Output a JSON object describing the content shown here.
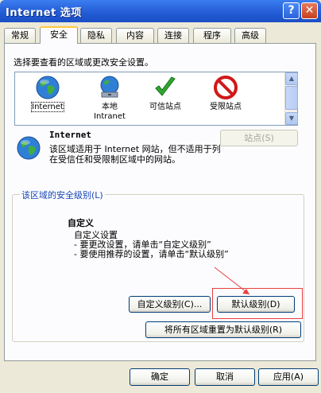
{
  "window": {
    "title": "Internet 选项"
  },
  "tabs": [
    {
      "label": "常规"
    },
    {
      "label": "安全",
      "active": true
    },
    {
      "label": "隐私"
    },
    {
      "label": "内容"
    },
    {
      "label": "连接"
    },
    {
      "label": "程序"
    },
    {
      "label": "高级"
    }
  ],
  "security": {
    "prompt": "选择要查看的区域或更改安全设置。",
    "zones": [
      {
        "label": "Internet",
        "icon": "globe-icon",
        "selected": true
      },
      {
        "label": "本地\nIntranet",
        "icon": "intranet-globe-icon"
      },
      {
        "label": "可信站点",
        "icon": "check-icon"
      },
      {
        "label": "受限站点",
        "icon": "no-entry-icon"
      }
    ],
    "zone_title": "Internet",
    "zone_description": "该区域适用于 Internet 网站，但不适用于列在受信任和受限制区域中的网站。",
    "sites_button": "站点(S)",
    "level_group_label": "该区域的安全级别(L)",
    "level_title": "自定义",
    "level_description": "自定义设置\n- 要更改设置，请单击“自定义级别”\n- 要使用推荐的设置，请单击“默认级别”",
    "custom_level_button": "自定义级别(C)...",
    "default_level_button": "默认级别(D)",
    "reset_all_button": "将所有区域重置为默认级别(R)"
  },
  "footer": {
    "ok_button": "确定",
    "cancel_button": "取消",
    "apply_button": "应用(A)"
  },
  "colors": {
    "title_bar": "#2a65dd",
    "highlight": "#e84040",
    "tab_accent": "#ffc83c"
  }
}
